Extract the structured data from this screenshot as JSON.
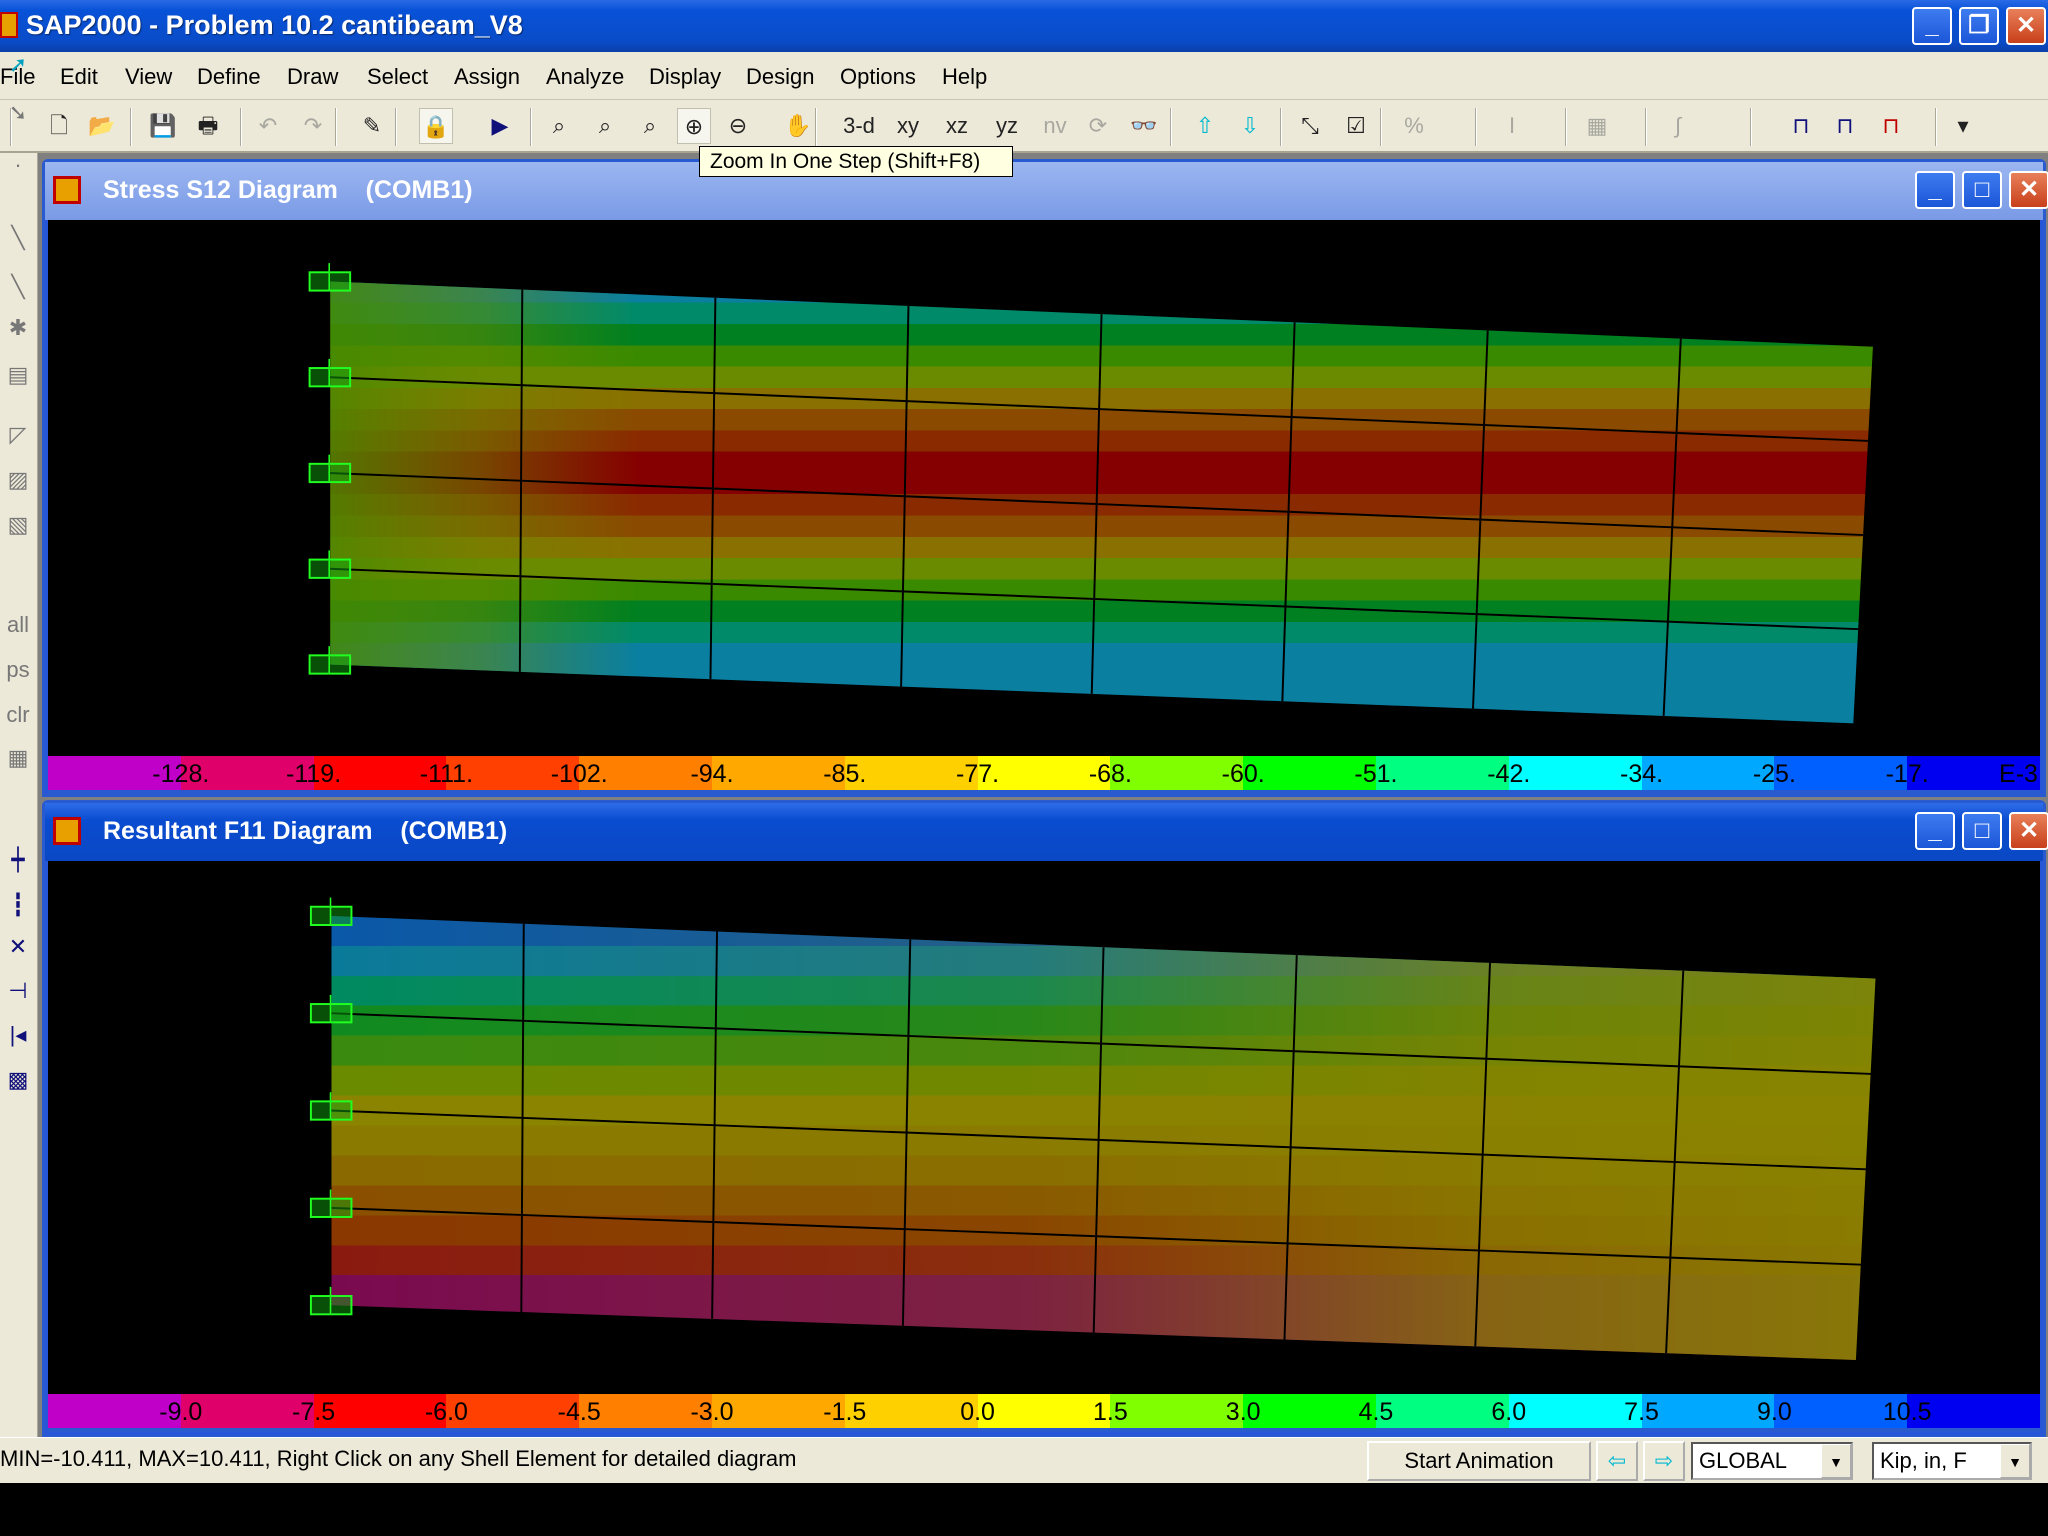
{
  "app": {
    "title": "SAP2000 - Problem 10.2 cantibeam_V8"
  },
  "menu": [
    "File",
    "Edit",
    "View",
    "Define",
    "Draw",
    "Select",
    "Assign",
    "Analyze",
    "Display",
    "Design",
    "Options",
    "Help"
  ],
  "toolbar": {
    "buttons": [
      {
        "id": "new",
        "icon": "new-file-icon"
      },
      {
        "id": "open",
        "icon": "open-folder-icon"
      },
      {
        "id": "save",
        "icon": "save-icon"
      },
      {
        "id": "print",
        "icon": "print-icon"
      },
      {
        "id": "undo",
        "icon": "undo-icon"
      },
      {
        "id": "redo",
        "icon": "redo-icon"
      },
      {
        "id": "edit",
        "icon": "pencil-icon"
      },
      {
        "id": "lock",
        "icon": "lock-icon"
      },
      {
        "id": "run",
        "icon": "run-analysis-icon"
      },
      {
        "id": "rubber-band-zoom",
        "icon": "zoom-window-icon"
      },
      {
        "id": "restore-full-view",
        "icon": "zoom-full-icon"
      },
      {
        "id": "restore-previous-zoom",
        "icon": "zoom-previous-icon"
      },
      {
        "id": "zoom-in",
        "icon": "zoom-in-icon"
      },
      {
        "id": "zoom-out",
        "icon": "zoom-out-icon"
      },
      {
        "id": "pan",
        "icon": "pan-hand-icon"
      },
      {
        "id": "view-3d",
        "label": "3-d"
      },
      {
        "id": "view-xy",
        "label": "xy"
      },
      {
        "id": "view-xz",
        "label": "xz"
      },
      {
        "id": "view-yz",
        "label": "yz"
      },
      {
        "id": "view-nv",
        "label": "nv"
      },
      {
        "id": "rotate",
        "icon": "rotate-icon"
      },
      {
        "id": "perspective",
        "icon": "perspective-icon"
      },
      {
        "id": "move-up",
        "icon": "arrow-up-icon"
      },
      {
        "id": "move-down",
        "icon": "arrow-down-icon"
      },
      {
        "id": "shrink",
        "icon": "shrink-objects-icon"
      },
      {
        "id": "set-display",
        "icon": "checkbox-icon"
      },
      {
        "id": "assign-percent",
        "icon": "percent-icon"
      },
      {
        "id": "section",
        "icon": "i-section-icon"
      },
      {
        "id": "area-fill",
        "icon": "fill-pattern-icon"
      },
      {
        "id": "spring",
        "icon": "spring-icon"
      },
      {
        "id": "frame-2d",
        "icon": "frame-icon"
      },
      {
        "id": "frame-h",
        "icon": "frame-h-icon"
      },
      {
        "id": "frame-deformed",
        "icon": "frame-deformed-icon"
      },
      {
        "id": "more",
        "icon": "chevron-down-icon"
      }
    ],
    "tooltip": "Zoom In One Step  (Shift+F8)"
  },
  "windows": [
    {
      "title": "Stress S12 Diagram",
      "combo": "(COMB1)",
      "state": "inactive",
      "legend": [
        "-128.",
        "-119.",
        "-111.",
        "-102.",
        "-94.",
        "-85.",
        "-77.",
        "-68.",
        "-60.",
        "-51.",
        "-42.",
        "-34.",
        "-25.",
        "-17.",
        "E-3"
      ]
    },
    {
      "title": "Resultant F11 Diagram",
      "combo": "(COMB1)",
      "state": "active",
      "legend": [
        "-9.0",
        "-7.5",
        "-6.0",
        "-4.5",
        "-3.0",
        "-1.5",
        "0.0",
        "1.5",
        "3.0",
        "4.5",
        "6.0",
        "7.5",
        "9.0",
        "10.5",
        ""
      ]
    }
  ],
  "legend_colors": [
    "#c000c8",
    "#e0006a",
    "#ff0000",
    "#ff4000",
    "#ff8000",
    "#ffa800",
    "#ffd000",
    "#ffff00",
    "#80ff00",
    "#00ff00",
    "#00ff80",
    "#00ffff",
    "#00a8ff",
    "#0060ff",
    "#0000f0"
  ],
  "status": {
    "message": "MIN=-10.411, MAX=10.411, Right Click on any Shell Element for detailed diagram",
    "animation_button": "Start Animation",
    "coord_system": "GLOBAL",
    "units": "Kip, in, F"
  }
}
